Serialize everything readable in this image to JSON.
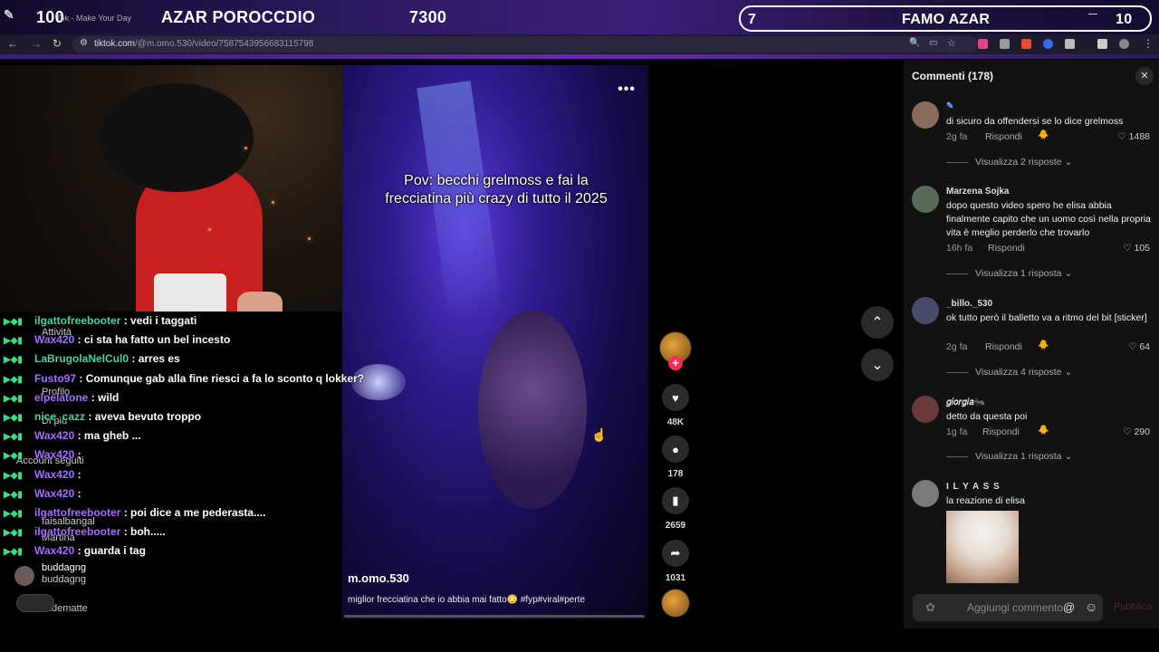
{
  "overlay": {
    "left_count": "100",
    "stream_title": "AZAR POROCCDIO",
    "center_count": "7300",
    "right_num": "7",
    "right_title": "FAMO AZAR",
    "right_count": "10"
  },
  "browser": {
    "tab_title": "Tok - Make Your Day",
    "url_domain": "tiktok.com",
    "url_path": "/@m.omo.530/video/7587543956683115798"
  },
  "video": {
    "caption": "Pov: becchi grelmoss e fai la frecciatina più crazy di tutto il 2025",
    "username": "m.omo.530",
    "description": "miglior frecciatina che io abbia mai fatto😳 #fyp#viral#perte",
    "likes": "48K",
    "comments": "178",
    "saves": "2659",
    "shares": "1031"
  },
  "chat": [
    {
      "user": "ilgattofreebooter",
      "msg": ": vedi i taggati",
      "color": "green"
    },
    {
      "user": "Wax420",
      "msg": ": ci sta ha fatto un bel incesto",
      "color": "purple"
    },
    {
      "user": "LaBrugolaNelCul0",
      "msg": ": arres es",
      "color": "green"
    },
    {
      "user": "Fusto97",
      "msg": ": Comunque gab alla fine riesci a fa lo sconto q lokker?",
      "color": "purple"
    },
    {
      "user": "elpelatone",
      "msg": ": wild",
      "color": "purple"
    },
    {
      "user": "nice_cazz",
      "msg": ": aveva bevuto troppo",
      "color": "green"
    },
    {
      "user": "Wax420",
      "msg": ": ma gheb ...",
      "color": "purple"
    },
    {
      "user": "Wax420",
      "msg": ":",
      "color": "purple"
    },
    {
      "user": "Wax420",
      "msg": ":",
      "color": "purple"
    },
    {
      "user": "Wax420",
      "msg": ":",
      "color": "purple"
    },
    {
      "user": "ilgattofreebooter",
      "msg": ": poi dice a me pederasta....",
      "color": "purple"
    },
    {
      "user": "ilgattofreebooter",
      "msg": ": boh.....",
      "color": "purple"
    },
    {
      "user": "Wax420",
      "msg": ": guarda i tag",
      "color": "purple"
    }
  ],
  "sidebar_bg": {
    "activity": "Attività",
    "profile": "Profilo",
    "more": "Di più",
    "following": "Account seguiti",
    "buddagng": "buddagng",
    "buddagng2": "buddagng",
    "faisal": "faisalbangal",
    "martina": "Martina",
    "smatte": "sfidematte"
  },
  "comments": {
    "title": "Commenti (178)",
    "add_placeholder": "Aggiungi commento...",
    "publish": "Pubblica",
    "items": [
      {
        "name": "",
        "text": "di sicuro da offendersi se lo dice grelmoss",
        "time": "2g fa",
        "reply": "Rispondi",
        "likes": "1488",
        "more": "Visualizza 2 risposte"
      },
      {
        "name": "Marzena Sojka",
        "text": "dopo questo video spero he elisa abbia finalmente capito che un uomo così nella propria vita è meglio perderlo che trovarlo",
        "time": "16h fa",
        "reply": "Rispondi",
        "likes": "105",
        "more": "Visualizza 1 risposta"
      },
      {
        "name": "_billo._530",
        "text": "ok tutto però il balletto va a ritmo del bit [sticker]",
        "time": "2g fa",
        "reply": "Rispondi",
        "likes": "64",
        "more": "Visualizza 4 risposte"
      },
      {
        "name": "𝑔𝑖𝑜𝑟𝑔𝑖𝑎🐜",
        "text": "detto da questa poi",
        "time": "1g fa",
        "reply": "Rispondi",
        "likes": "290",
        "more": "Visualizza 1 risposta"
      },
      {
        "name": "I L Y A S S",
        "text": "la reazione di elisa",
        "time": "",
        "reply": "",
        "likes": "",
        "more": ""
      }
    ]
  },
  "colors": {
    "accent_purple": "#a66bff",
    "accent_green": "#4ccfa0",
    "like_red": "#fe2c55"
  }
}
